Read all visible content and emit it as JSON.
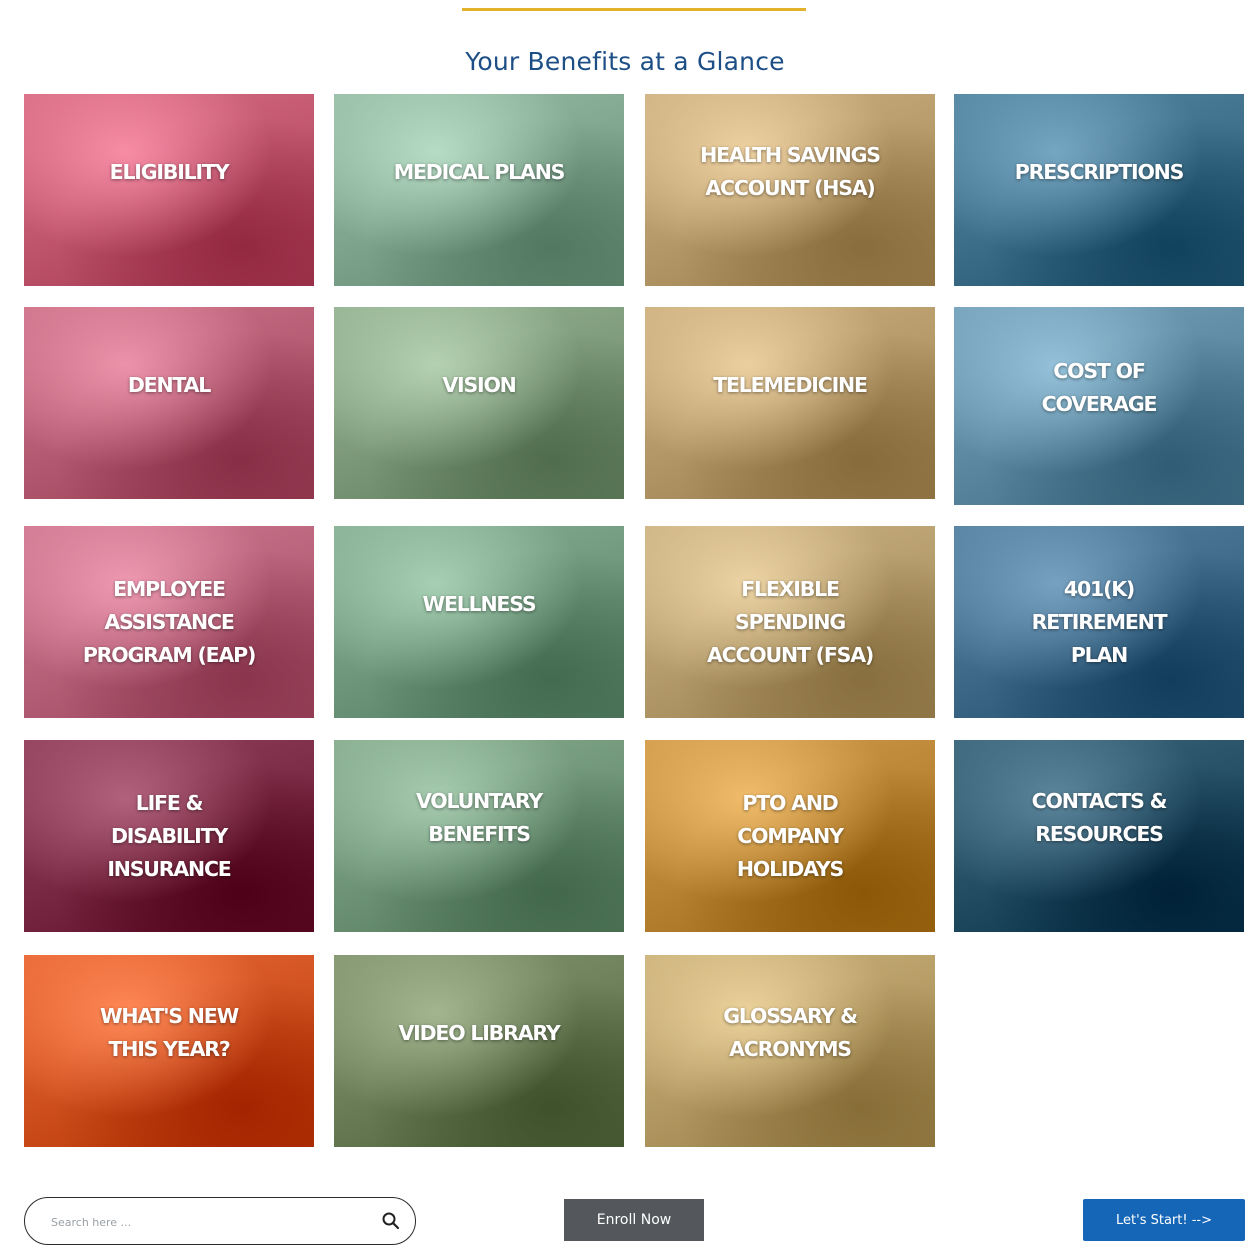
{
  "page": {
    "title": "Your Benefits at a Glance"
  },
  "tiles": [
    {
      "id": "eligibility",
      "label": "ELIGIBILITY",
      "tint": "#c0556e"
    },
    {
      "id": "medical-plans",
      "label": "MEDICAL PLANS",
      "tint": "#7fa58e"
    },
    {
      "id": "hsa",
      "label": "HEALTH SAVINGS\nACCOUNT (HSA)",
      "tint": "#b79a6a"
    },
    {
      "id": "prescriptions",
      "label": "PRESCRIPTIONS",
      "tint": "#3e6f8a"
    },
    {
      "id": "dental",
      "label": "DENTAL",
      "tint": "#b55b72"
    },
    {
      "id": "vision",
      "label": "VISION",
      "tint": "#7d9a7a"
    },
    {
      "id": "telemedicine",
      "label": "TELEMEDICINE",
      "tint": "#b49868"
    },
    {
      "id": "cost-of-coverage",
      "label": "COST OF\nCOVERAGE",
      "tint": "#5d8aa2"
    },
    {
      "id": "eap",
      "label": "EMPLOYEE\nASSISTANCE\nPROGRAM (EAP)",
      "tint": "#b7627a"
    },
    {
      "id": "wellness",
      "label": "WELLNESS",
      "tint": "#6f987c"
    },
    {
      "id": "fsa",
      "label": "FLEXIBLE\nSPENDING\nACCOUNT (FSA)",
      "tint": "#b59c6c"
    },
    {
      "id": "401k",
      "label": "401(K)\nRETIREMENT\nPLAN",
      "tint": "#3f6a8a"
    },
    {
      "id": "life-disability",
      "label": "LIFE &\nDISABILITY\nINSURANCE",
      "tint": "#7a2a44"
    },
    {
      "id": "voluntary",
      "label": "VOLUNTARY\nBENEFITS",
      "tint": "#6f9478"
    },
    {
      "id": "pto",
      "label": "PTO AND\nCOMPANY\nHOLIDAYS",
      "tint": "#b98534"
    },
    {
      "id": "contacts",
      "label": "CONTACTS &\nRESOURCES",
      "tint": "#244e64"
    },
    {
      "id": "whats-new",
      "label": "WHAT'S NEW\nTHIS YEAR?",
      "tint": "#d0511f"
    },
    {
      "id": "video-library",
      "label": "VIDEO LIBRARY",
      "tint": "#6b7e58"
    },
    {
      "id": "glossary",
      "label": "GLOSSARY &\nACRONYMS",
      "tint": "#b49a63"
    }
  ],
  "search": {
    "placeholder": "Search here ...",
    "icon": "search-icon"
  },
  "buttons": {
    "enroll": "Enroll Now",
    "start": "Let's Start! -->"
  },
  "colors": {
    "title": "#1d4f86",
    "rule": "#e4b22a",
    "enroll_bg": "#54585c",
    "start_bg": "#1566b7"
  }
}
